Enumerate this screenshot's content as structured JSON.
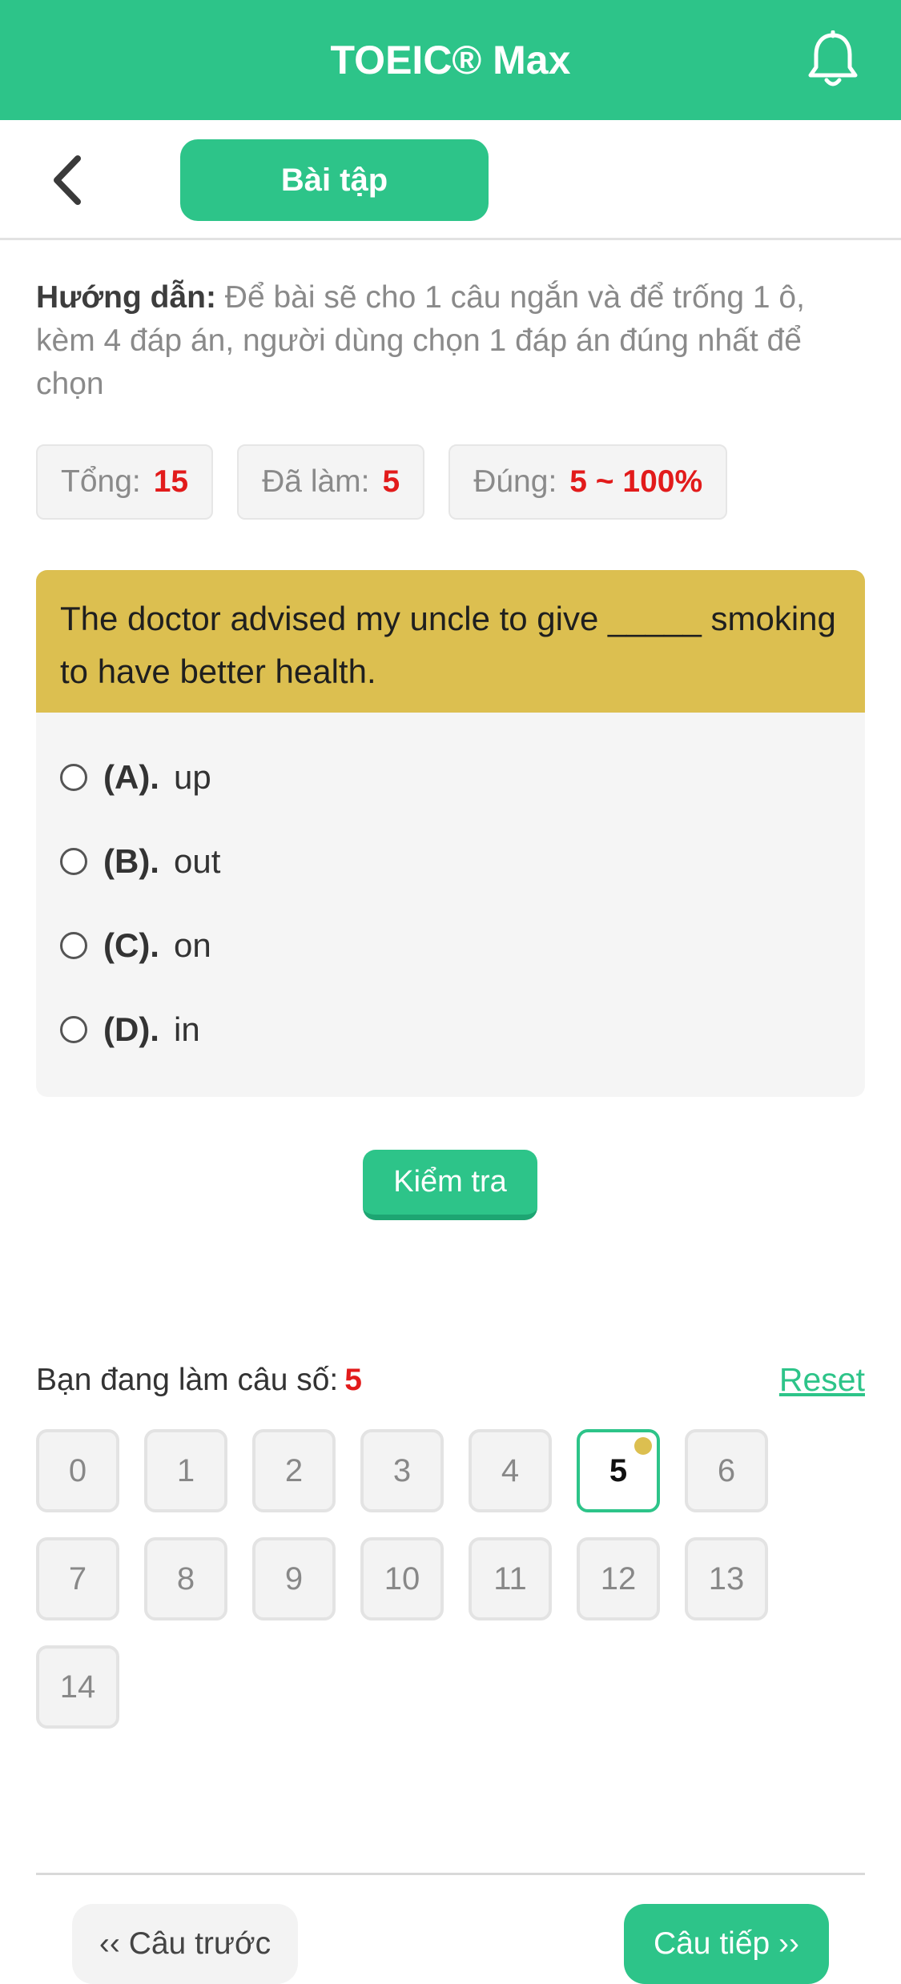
{
  "colors": {
    "brand_green": "#2dc489",
    "question_header": "#dcbf50",
    "highlight_red": "#e21b1b"
  },
  "header": {
    "title": "TOEIC® Max",
    "notification_icon": "bell-icon"
  },
  "subheader": {
    "back_icon": "chevron-left-icon",
    "tab_label": "Bài tập"
  },
  "instructions": {
    "label": "Hướng dẫn:",
    "text": "Để bài sẽ cho 1 câu ngắn và để trống 1 ô, kèm 4 đáp án, người dùng chọn 1 đáp án đúng nhất để chọn"
  },
  "stats": [
    {
      "label": "Tổng:",
      "value": "15"
    },
    {
      "label": "Đã làm:",
      "value": "5"
    },
    {
      "label": "Đúng:",
      "value": "5 ~ 100%"
    }
  ],
  "question": {
    "text": "The doctor advised my uncle to give _____ smoking to have better health.",
    "options": [
      {
        "letter": "(A).",
        "text": "up"
      },
      {
        "letter": "(B).",
        "text": "out"
      },
      {
        "letter": "(C).",
        "text": "on"
      },
      {
        "letter": "(D).",
        "text": "in"
      }
    ]
  },
  "check_button": "Kiểm tra",
  "progress": {
    "label": "Bạn đang làm câu số:",
    "current": "5",
    "reset_label": "Reset"
  },
  "question_numbers": [
    "0",
    "1",
    "2",
    "3",
    "4",
    "5",
    "6",
    "7",
    "8",
    "9",
    "10",
    "11",
    "12",
    "13",
    "14"
  ],
  "active_question": "5",
  "navigation": {
    "prev_label": "‹‹ Câu trước",
    "next_label": "Câu tiếp ››"
  }
}
